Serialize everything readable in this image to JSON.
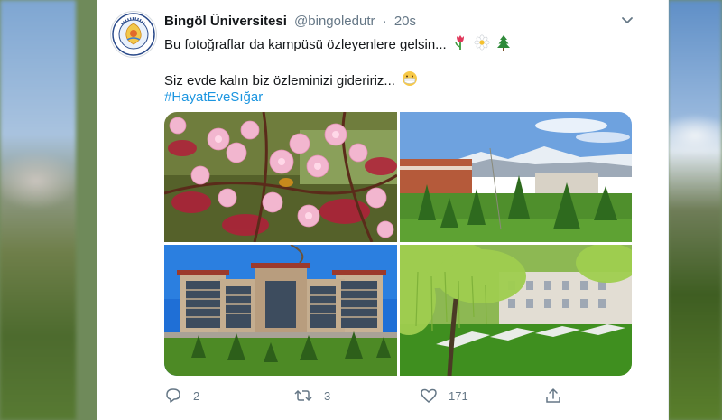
{
  "tweet": {
    "display_name": "Bingöl Üniversitesi",
    "handle": "@bingoledutr",
    "separator": "·",
    "time": "20s",
    "line1": "Bu fotoğraflar da kampüsü özleyenlere gelsin...",
    "line2": "Siz evde kalın biz özleminizi gideririz...",
    "hashtag": "#HayatEveSığar"
  },
  "avatar": {
    "ring_text": "BİNGÖL ÜNİVERSİTESİ",
    "year": "2007"
  },
  "actions": {
    "replies": "2",
    "retweets": "3",
    "likes": "171"
  },
  "icons": [
    "avatar-logo",
    "caret-down-icon",
    "tulip-icon",
    "daisy-icon",
    "tree-icon",
    "face-mask-icon",
    "reply-icon",
    "retweet-icon",
    "like-icon",
    "share-icon"
  ],
  "colors": {
    "hashtag": "#1b95e0",
    "muted": "#657786",
    "text": "#14171a"
  }
}
